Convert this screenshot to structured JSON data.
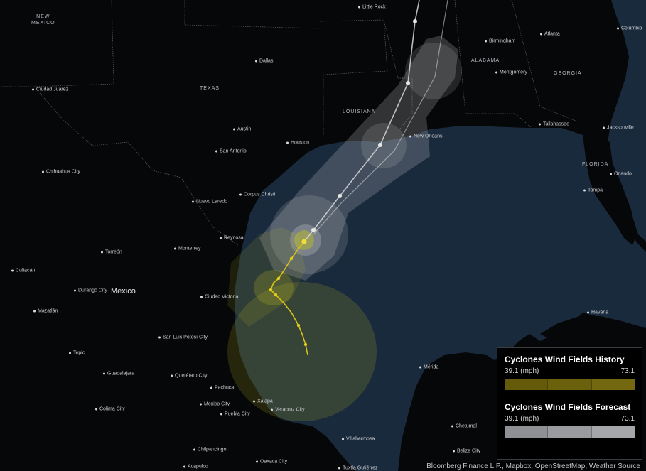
{
  "colors": {
    "ocean": "#1a2a3d",
    "land": "#060708",
    "history_track": "#d9c21a",
    "forecast_track": "#d8d8d8",
    "history_field": "#c2c21f",
    "forecast_field": "#d3d3d3"
  },
  "regions": [
    {
      "text": "NEW\nMEXICO"
    },
    {
      "text": "TEXAS"
    },
    {
      "text": "LOUISIANA"
    },
    {
      "text": "ALABAMA"
    },
    {
      "text": "GEORGIA"
    },
    {
      "text": "FLORIDA"
    }
  ],
  "countries": [
    {
      "text": "Mexico"
    }
  ],
  "cities": [
    "Little Rock",
    "Columbia",
    "Birmingham",
    "Atlanta",
    "Dallas",
    "Montgomery",
    "Ciudad Juárez",
    "New Orleans",
    "Tallahassee",
    "Jacksonville",
    "Austin",
    "Houston",
    "San Antonio",
    "Chihuahua City",
    "Orlando",
    "Tampa",
    "Corpus Christi",
    "Nuevo Laredo",
    "Reynosa",
    "Monterrey",
    "Torreón",
    "Culiacán",
    "Durango City",
    "Ciudad Victoria",
    "Mazatlán",
    "Havana",
    "San Luis Potosí City",
    "Tepic",
    "Guadalajara",
    "Querétaro City",
    "Mérida",
    "Pachuca",
    "Mexico City",
    "Xalapa",
    "Colima City",
    "Puebla City",
    "Veracruz City",
    "Chetumal",
    "Villahermosa",
    "Chilpancingo",
    "Belize City",
    "Acapulco",
    "Oaxaca City",
    "Tuxtla Gutiérrez"
  ],
  "legend": {
    "history": {
      "title": "Cyclones Wind Fields History",
      "min_label": "39.1 (mph)",
      "max_label": "73.1",
      "colors": [
        "#645a0a",
        "#6b610d",
        "#736810"
      ]
    },
    "forecast": {
      "title": "Cyclones Wind Fields Forecast",
      "min_label": "39.1 (mph)",
      "max_label": "73.1",
      "colors": [
        "#8f9094",
        "#9a9b9f",
        "#a5a6aa"
      ]
    }
  },
  "attribution": "Bloomberg Finance L.P., Mapbox, OpenStreetMap, Weather Source"
}
